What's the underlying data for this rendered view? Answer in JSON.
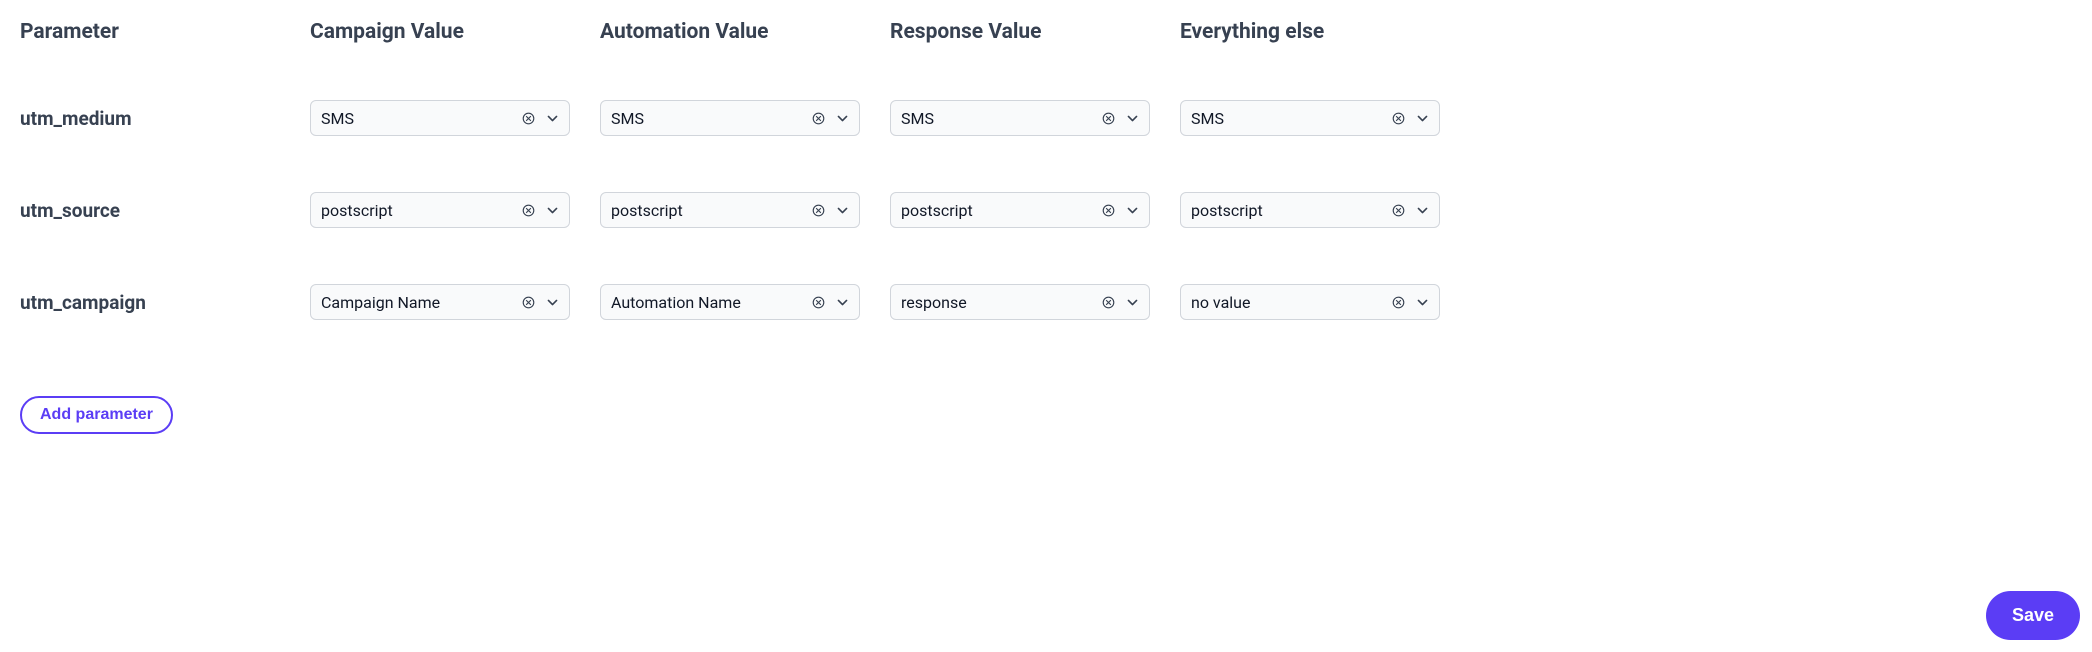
{
  "headers": {
    "parameter": "Parameter",
    "campaign": "Campaign Value",
    "automation": "Automation Value",
    "response": "Response Value",
    "everything": "Everything else"
  },
  "rows": [
    {
      "param": "utm_medium",
      "campaign": "SMS",
      "automation": "SMS",
      "response": "SMS",
      "everything": "SMS"
    },
    {
      "param": "utm_source",
      "campaign": "postscript",
      "automation": "postscript",
      "response": "postscript",
      "everything": "postscript"
    },
    {
      "param": "utm_campaign",
      "campaign": "Campaign Name",
      "automation": "Automation Name",
      "response": "response",
      "everything": "no value"
    }
  ],
  "buttons": {
    "add_parameter": "Add parameter",
    "save": "Save"
  }
}
